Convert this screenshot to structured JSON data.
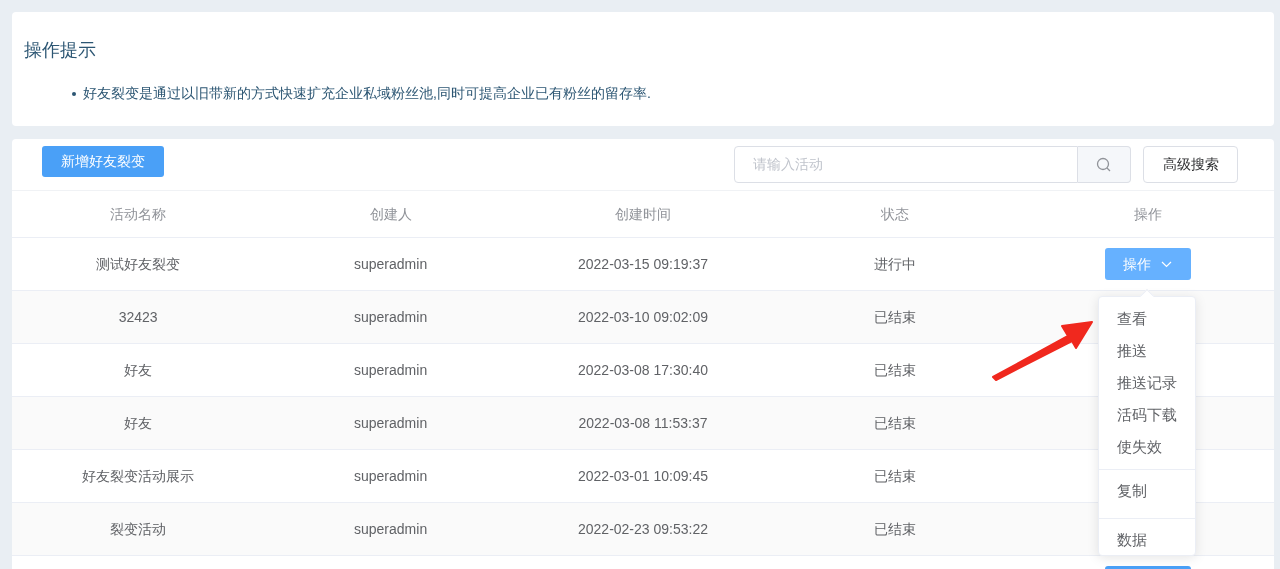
{
  "tips": {
    "title": "操作提示",
    "items": [
      "好友裂变是通过以旧带新的方式快速扩充企业私域粉丝池,同时可提高企业已有粉丝的留存率."
    ]
  },
  "toolbar": {
    "add_button": "新增好友裂变",
    "search": {
      "placeholder": "请输入活动"
    },
    "advanced_button": "高级搜索"
  },
  "table": {
    "columns": [
      "活动名称",
      "创建人",
      "创建时间",
      "状态",
      "操作"
    ],
    "rows": [
      {
        "name": "测试好友裂变",
        "creator": "superadmin",
        "time": "2022-03-15 09:19:37",
        "status": "进行中",
        "action": "操作"
      },
      {
        "name": "32423",
        "creator": "superadmin",
        "time": "2022-03-10 09:02:09",
        "status": "已结束"
      },
      {
        "name": "好友",
        "creator": "superadmin",
        "time": "2022-03-08 17:30:40",
        "status": "已结束"
      },
      {
        "name": "好友",
        "creator": "superadmin",
        "time": "2022-03-08 11:53:37",
        "status": "已结束"
      },
      {
        "name": "好友裂变活动展示",
        "creator": "superadmin",
        "time": "2022-03-01 10:09:45",
        "status": "已结束"
      },
      {
        "name": "裂变活动",
        "creator": "superadmin",
        "time": "2022-02-23 09:53:22",
        "status": "已结束"
      }
    ]
  },
  "dropdown_menu": {
    "items": [
      {
        "label": "查看",
        "divided": false
      },
      {
        "label": "推送",
        "divided": false
      },
      {
        "label": "推送记录",
        "divided": false
      },
      {
        "label": "活码下载",
        "divided": false
      },
      {
        "label": "使失效",
        "divided": false
      },
      {
        "label": "复制",
        "divided": true
      },
      {
        "label": "数据",
        "divided": true
      }
    ]
  }
}
